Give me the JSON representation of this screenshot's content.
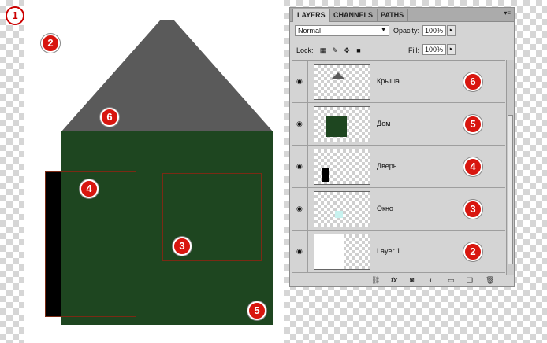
{
  "badges": {
    "b1": "1",
    "b2": "2",
    "b3": "3",
    "b4": "4",
    "b5": "5",
    "b6": "6"
  },
  "panel": {
    "tabs": [
      "LAYERS",
      "CHANNELS",
      "PATHS"
    ],
    "blend_mode": "Normal",
    "opacity_label": "Opacity:",
    "opacity_value": "100%",
    "lock_label": "Lock:",
    "fill_label": "Fill:",
    "fill_value": "100%",
    "layers": [
      {
        "name": "Крыша",
        "badge": "6"
      },
      {
        "name": "Дом",
        "badge": "5"
      },
      {
        "name": "Дверь",
        "badge": "4"
      },
      {
        "name": "Окно",
        "badge": "3"
      },
      {
        "name": "Layer 1",
        "badge": "2"
      }
    ]
  },
  "colors": {
    "house": "#1e4620",
    "roof": "#5a5a5a",
    "door": "#000000",
    "badge": "#d8160f"
  },
  "icons": [
    "eye-icon",
    "link-icon",
    "fx-icon",
    "mask-icon",
    "adjustment-icon",
    "folder-icon",
    "new-layer-icon",
    "trash-icon",
    "lock-transparency-icon",
    "lock-brush-icon",
    "lock-move-icon",
    "lock-all-icon",
    "panel-menu-icon"
  ]
}
